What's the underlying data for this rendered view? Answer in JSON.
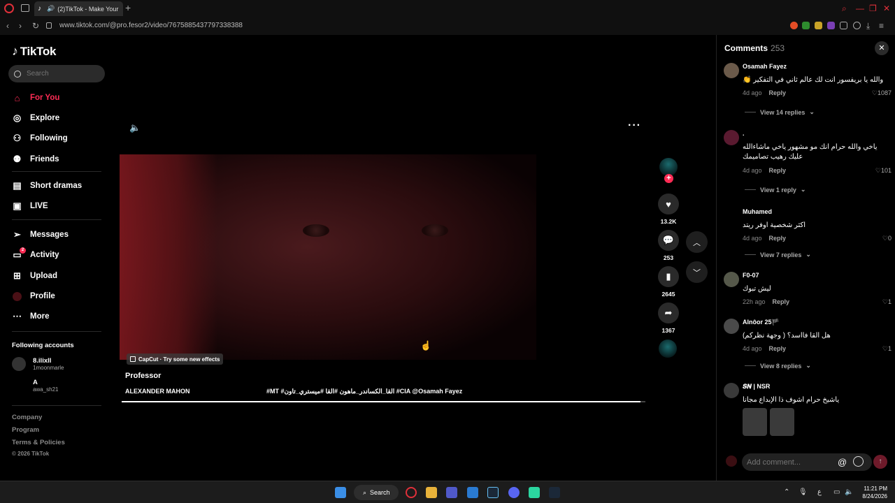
{
  "browser": {
    "tab_title": "(2)TikTok - Make Your",
    "url": "www.tiktok.com/@pro.fesor2/video/7675885437797338388"
  },
  "sidebar": {
    "logo": "TikTok",
    "search_placeholder": "Search",
    "nav": [
      {
        "label": "For You",
        "icon": "home-icon"
      },
      {
        "label": "Explore",
        "icon": "compass-icon"
      },
      {
        "label": "Following",
        "icon": "user-plus-icon"
      },
      {
        "label": "Friends",
        "icon": "friends-icon"
      },
      {
        "label": "Short dramas",
        "icon": "film-icon"
      },
      {
        "label": "LIVE",
        "icon": "tv-icon"
      },
      {
        "label": "Messages",
        "icon": "paper-plane-icon"
      },
      {
        "label": "Activity",
        "icon": "inbox-icon",
        "badge": "2"
      },
      {
        "label": "Upload",
        "icon": "plus-square-icon"
      },
      {
        "label": "Profile",
        "icon": "avatar-icon"
      },
      {
        "label": "More",
        "icon": "more-dots-icon"
      }
    ],
    "following_title": "Following accounts",
    "following": [
      {
        "name": "8.ilixll",
        "handle": "1moonmarle"
      },
      {
        "name": "A",
        "handle": "awa_sh21"
      }
    ],
    "footer": [
      "Company",
      "Program",
      "Terms & Policies"
    ],
    "copyright": "© 2026 TikTok"
  },
  "video": {
    "capcut": "CapCut · Try some new effects",
    "title": "Professor",
    "music": "ALEXANDER MAHON",
    "description": "#MT #القا_الكساندر_ماهون #القا #ميستري_تاون #CIA @Osamah Fayez",
    "progress": 0.99,
    "likes": "13.2K",
    "comments": "253",
    "saves": "2645",
    "shares": "1367"
  },
  "comments": {
    "title": "Comments",
    "count": "253",
    "items": [
      {
        "user": "Osamah Fayez",
        "text": "والله يا بريفسور انت لك عالم ثاني في التفكير 👏",
        "time": "4d ago",
        "reply": "Reply",
        "likes": "1087",
        "view": "View 14 replies"
      },
      {
        "user": ".",
        "text": "ياخي والله حرام انك مو مشهور ياخي ماشاءالله\nعليك رهيب تصاميمك",
        "time": "4d ago",
        "reply": "Reply",
        "likes": "101",
        "view": "View 1 reply"
      },
      {
        "user": "Muhamed",
        "text": "اكثر شخصية اوفر ريتد",
        "time": "4d ago",
        "reply": "Reply",
        "likes": "0",
        "view": "View 7 replies"
      },
      {
        "user": "F0-07",
        "text": "ليش تبوك",
        "time": "22h ago",
        "reply": "Reply",
        "likes": "1",
        "view": ""
      },
      {
        "user": "Alnôor 25🏴",
        "text": "هل القا فااسد؟ ( وجهة نظركم)",
        "time": "4d ago",
        "reply": "Reply",
        "likes": "1",
        "view": "View 8 replies"
      },
      {
        "user": "𝑺𝑵 | NSR",
        "text": "ياشيخ حرام اشوف ذا الإبداع مجانا",
        "time": "",
        "reply": "",
        "likes": "",
        "view": ""
      }
    ],
    "add_placeholder": "Add comment..."
  },
  "taskbar": {
    "search": "Search",
    "lang": "ع",
    "time": "11:21 PM",
    "date": "8/24/2026"
  },
  "colors": {
    "accent": "#fe2c55",
    "opera": "#e0303a"
  }
}
